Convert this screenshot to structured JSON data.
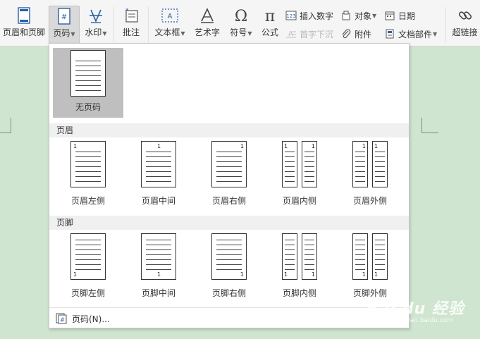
{
  "ribbon": {
    "header_footer": "页眉和页脚",
    "page_number": "页码",
    "watermark": "水印",
    "comment": "批注",
    "text_box": "文本框",
    "word_art": "艺术字",
    "symbol": "符号",
    "formula": "公式",
    "insert_number": "插入数字",
    "drop_cap": "首字下沉",
    "object": "对象",
    "attachment": "附件",
    "date": "日期",
    "doc_parts": "文档部件",
    "hyperlink": "超链接"
  },
  "dropdown": {
    "none_label": "无页码",
    "header_section": "页眉",
    "header_items": [
      "页眉左侧",
      "页眉中间",
      "页眉右侧",
      "页眉内侧",
      "页眉外侧"
    ],
    "footer_section": "页脚",
    "footer_items": [
      "页脚左侧",
      "页脚中间",
      "页脚右侧",
      "页脚内侧",
      "页脚外侧"
    ],
    "page_number_cmd": "页码(N)...",
    "thumb_number": "1"
  },
  "watermark_logo": {
    "brand": "Bai du 经验",
    "url": "jingyan.baidu.com"
  },
  "colors": {
    "doc_background": "#cfe5cf",
    "ribbon_background": "#f5f5f5",
    "active_button": "#d9d9d9",
    "selected_tile": "#bfbfbf",
    "section_header": "#f0f0f0"
  }
}
